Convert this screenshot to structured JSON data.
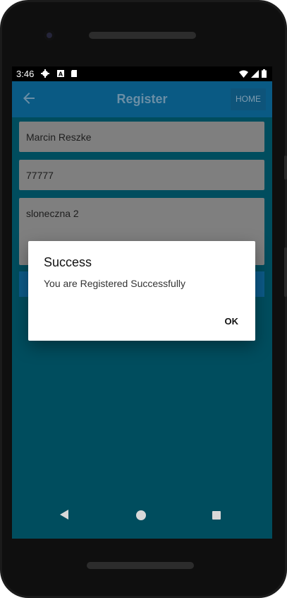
{
  "status_bar": {
    "time": "3:46",
    "icons": [
      "gear-icon",
      "a-box-icon",
      "sd-card-icon"
    ],
    "right_icons": [
      "wifi-icon",
      "cellular-signal-icon",
      "battery-icon"
    ]
  },
  "app_bar": {
    "title": "Register",
    "home_label": "HOME",
    "back_icon": "arrow-left-icon"
  },
  "form": {
    "name_value": "Marcin Reszke",
    "phone_value": "77777",
    "address_value": "sloneczna 2"
  },
  "dialog": {
    "title": "Success",
    "message": "You are Registered Successfully",
    "ok_label": "OK"
  },
  "nav_bar": {
    "icons": [
      "back-triangle-icon",
      "home-circle-icon",
      "recents-square-icon"
    ]
  },
  "colors": {
    "screen_bg": "#004d5e",
    "app_bar": "#0a5a84",
    "dialog_bg": "#ffffff"
  }
}
